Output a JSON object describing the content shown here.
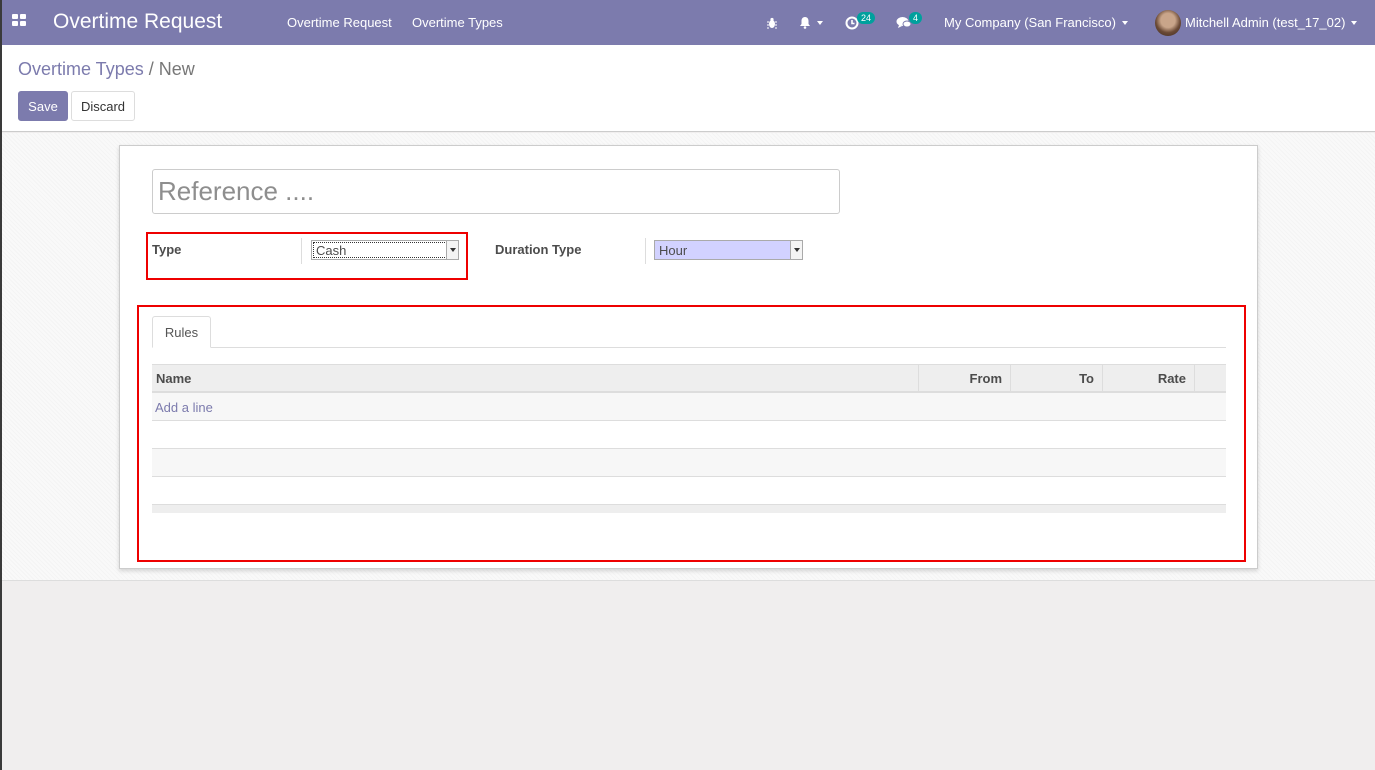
{
  "navbar": {
    "app_title": "Overtime Request",
    "menu": [
      {
        "label": "Overtime Request"
      },
      {
        "label": "Overtime Types"
      }
    ],
    "activity_count": "24",
    "messages_count": "4",
    "company": "My Company (San Francisco)",
    "user": "Mitchell Admin (test_17_02)"
  },
  "breadcrumb": {
    "parent": "Overtime Types",
    "separator": "/",
    "current": "New"
  },
  "buttons": {
    "save": "Save",
    "discard": "Discard"
  },
  "form": {
    "reference_placeholder": "Reference ....",
    "type_label": "Type",
    "type_value": "Cash",
    "duration_label": "Duration Type",
    "duration_value": "Hour"
  },
  "tabs": [
    {
      "label": "Rules"
    }
  ],
  "table": {
    "columns": [
      "Name",
      "From",
      "To",
      "Rate"
    ],
    "add_line": "Add a line"
  },
  "colors": {
    "brand": "#7c7bad",
    "highlight": "#ee0000",
    "badge": "#00a09d"
  }
}
